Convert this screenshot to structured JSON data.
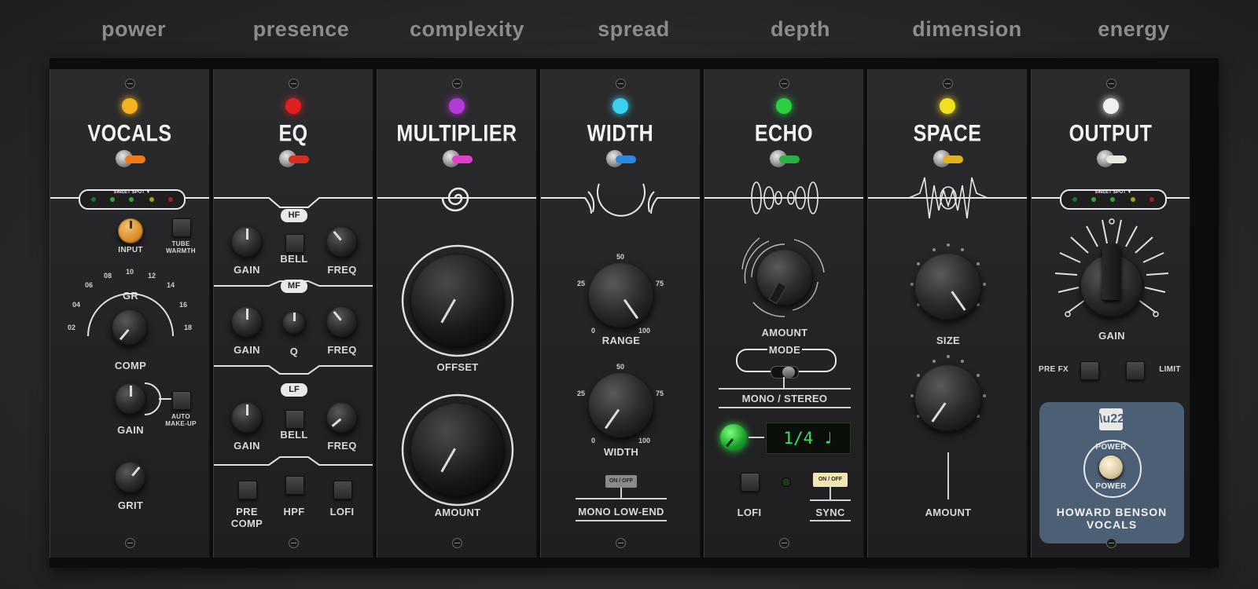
{
  "categories": [
    "power",
    "presence",
    "complexity",
    "spread",
    "depth",
    "dimension",
    "energy"
  ],
  "modules": {
    "vocals": {
      "title": "VOCALS",
      "led_color": "#f5b220",
      "lever_color": "#f07a1a",
      "sweet_spot": "SWEET SPOT ▼",
      "input": "INPUT",
      "tube_warmth": "TUBE\nWARMTH",
      "gr": "GR",
      "gr_ticks": [
        "02",
        "04",
        "06",
        "08",
        "10",
        "12",
        "14",
        "16",
        "18"
      ],
      "comp": "COMP",
      "gain": "GAIN",
      "auto_makeup": "AUTO\nMAKE-UP",
      "grit": "GRIT"
    },
    "eq": {
      "title": "EQ",
      "led_color": "#e02020",
      "lever_color": "#d43020",
      "hf": "HF",
      "mf": "MF",
      "lf": "LF",
      "gain": "GAIN",
      "bell": "BELL",
      "freq": "FREQ",
      "q": "Q",
      "pre_comp": "PRE\nCOMP",
      "hpf": "HPF",
      "lofi": "LOFI"
    },
    "multiplier": {
      "title": "MULTIPLIER",
      "led_color": "#b43ad8",
      "lever_color": "#e040c8",
      "offset": "OFFSET",
      "amount": "AMOUNT"
    },
    "width": {
      "title": "WIDTH",
      "led_color": "#3ad0f0",
      "lever_color": "#2a8ae0",
      "range": "RANGE",
      "width": "WIDTH",
      "ticks": [
        "0",
        "25",
        "50",
        "75",
        "100"
      ],
      "on_off": "ON / OFF",
      "mono_low_end": "MONO LOW-END"
    },
    "echo": {
      "title": "ECHO",
      "led_color": "#2ad040",
      "lever_color": "#2ab040",
      "amount": "AMOUNT",
      "mode": "MODE",
      "mono_stereo": "MONO / STEREO",
      "lcd": "1/4 ♩",
      "lofi": "LOFI",
      "on_off": "ON / OFF",
      "sync": "SYNC"
    },
    "space": {
      "title": "SPACE",
      "led_color": "#f0e020",
      "lever_color": "#e0b020",
      "size": "SIZE",
      "amount": "AMOUNT"
    },
    "output": {
      "title": "OUTPUT",
      "led_color": "#f0f0f0",
      "lever_color": "#e8e8e0",
      "sweet_spot": "SWEET SPOT ▼",
      "gain": "GAIN",
      "pre_fx": "PRE FX",
      "limit": "LIMIT",
      "power": "POWER",
      "brand": "HOWARD BENSON VOCALS"
    }
  }
}
